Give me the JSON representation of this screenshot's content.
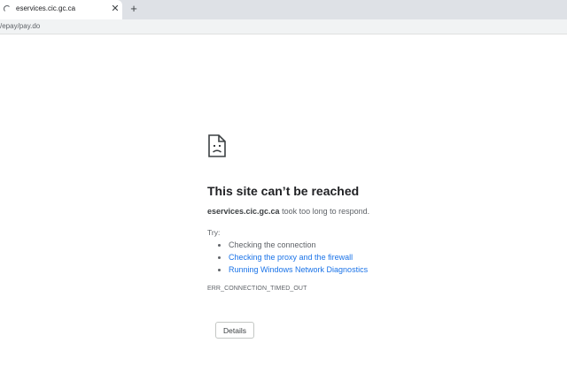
{
  "tab": {
    "title": "eservices.cic.gc.ca",
    "close_icon": "close-icon",
    "loading_icon": "loading-spinner-icon",
    "new_tab_icon": "plus-icon"
  },
  "toolbar": {
    "url": "/epay/pay.do"
  },
  "error": {
    "icon": "sad-page-icon",
    "heading": "This site can’t be reached",
    "host": "eservices.cic.gc.ca",
    "message": " took too long to respond.",
    "try_label": "Try:",
    "suggestions": [
      {
        "label": "Checking the connection",
        "link": false
      },
      {
        "label": "Checking the proxy and the firewall",
        "link": true
      },
      {
        "label": "Running Windows Network Diagnostics",
        "link": true
      }
    ],
    "code": "ERR_CONNECTION_TIMED_OUT",
    "details_label": "Details"
  },
  "colors": {
    "link": "#1a73e8",
    "tabstrip": "#dee1e6",
    "toolbar": "#f1f3f4"
  }
}
